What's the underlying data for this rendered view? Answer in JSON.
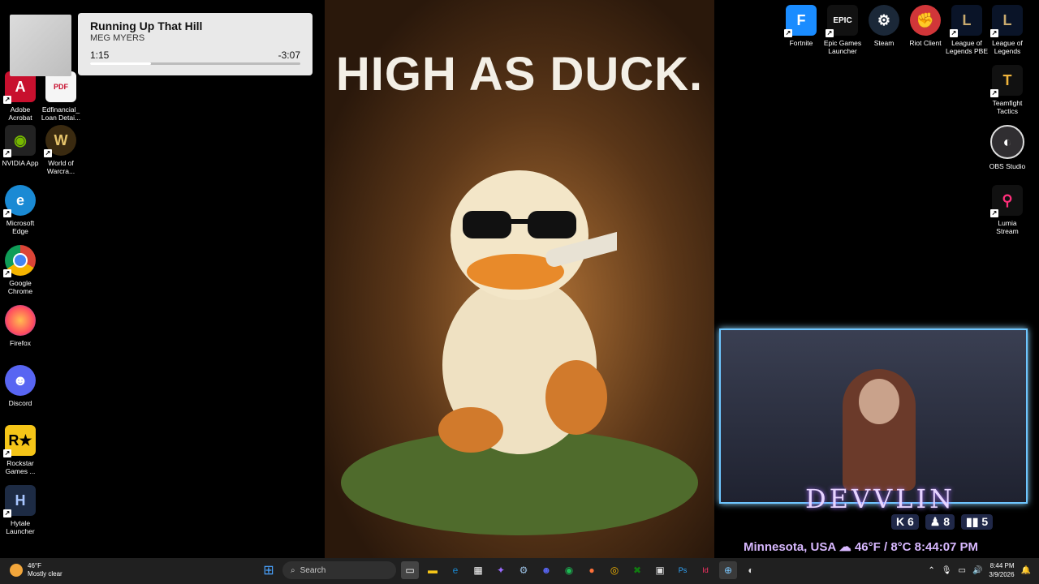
{
  "desktop_icons_left": [
    {
      "label": "Adobe\nAcrobat",
      "icon": "acrobat-icon"
    },
    {
      "label": "Edfinancial_\nLoan Detai...",
      "icon": "pdf-icon"
    },
    {
      "label": "NVIDIA App",
      "icon": "nvidia-icon"
    },
    {
      "label": "World of\nWarcra...",
      "icon": "wow-icon"
    },
    {
      "label": "Microsoft\nEdge",
      "icon": "edge-icon"
    },
    {
      "label": "Google\nChrome",
      "icon": "chrome-icon"
    },
    {
      "label": "Firefox",
      "icon": "firefox-icon"
    },
    {
      "label": "Discord",
      "icon": "discord-icon"
    },
    {
      "label": "Rockstar\nGames ...",
      "icon": "rockstar-icon"
    },
    {
      "label": "Hytale\nLauncher",
      "icon": "hytale-icon"
    }
  ],
  "desktop_icons_right": [
    {
      "label": "Fortnite",
      "icon": "fortnite-icon"
    },
    {
      "label": "Epic Games\nLauncher",
      "icon": "epic-icon"
    },
    {
      "label": "Steam",
      "icon": "steam-icon"
    },
    {
      "label": "Riot Client",
      "icon": "riot-icon"
    },
    {
      "label": "League of\nLegends PBE",
      "icon": "league-pbe-icon"
    },
    {
      "label": "League of\nLegends",
      "icon": "league-icon"
    },
    {
      "label": "Teamfight\nTactics",
      "icon": "tft-icon"
    },
    {
      "label": "OBS Studio",
      "icon": "obs-icon"
    },
    {
      "label": "Lumia\nStream",
      "icon": "lumia-icon"
    }
  ],
  "media": {
    "title": "Running Up That Hill",
    "artist": "MEG MYERS",
    "current": "1:15",
    "remaining": "-3:07",
    "progress": 0.29
  },
  "poster": {
    "headline": "HIGH AS DUCK."
  },
  "overlay": {
    "brand": "DEVVLIN",
    "stat1": "6",
    "stat2": "8",
    "stat3": "5",
    "location": "Minnesota, USA",
    "weather": "46°F / 8°C",
    "time": "8:44:07 PM"
  },
  "taskbar": {
    "temp": "46°F",
    "condition": "Mostly clear",
    "search_placeholder": "Search",
    "clock_time": "8:44 PM",
    "clock_date": "3/9/2026"
  },
  "colors": {
    "taskbar": "#202020",
    "overlay_accent": "#6ec6ff"
  }
}
